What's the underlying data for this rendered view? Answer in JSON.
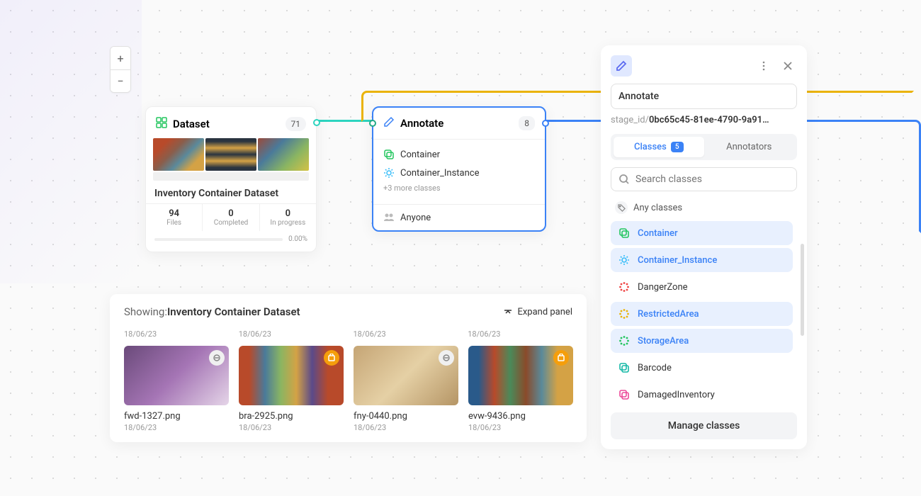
{
  "zoom": {
    "plus": "+",
    "minus": "−"
  },
  "dataset_node": {
    "title": "Dataset",
    "count": "71",
    "name": "Inventory Container Dataset",
    "stats": [
      {
        "num": "94",
        "label": "Files"
      },
      {
        "num": "0",
        "label": "Completed"
      },
      {
        "num": "0",
        "label": "In progress"
      }
    ],
    "progress_pct": "0.00%"
  },
  "annotate_node": {
    "title": "Annotate",
    "count": "8",
    "classes": [
      "Container",
      "Container_Instance"
    ],
    "more": "+3 more classes",
    "assignee": "Anyone"
  },
  "showing_panel": {
    "prefix": "Showing: ",
    "name": "Inventory Container Dataset",
    "expand": "Expand panel",
    "top_dates": [
      "18/06/23",
      "18/06/23",
      "18/06/23",
      "18/06/23"
    ],
    "files": [
      {
        "name": "fwd-1327.png",
        "date": "18/06/23",
        "badge": "gray"
      },
      {
        "name": "bra-2925.png",
        "date": "18/06/23",
        "badge": "orange"
      },
      {
        "name": "fny-0440.png",
        "date": "18/06/23",
        "badge": "gray"
      },
      {
        "name": "evw-9436.png",
        "date": "18/06/23",
        "badge": "orange"
      }
    ]
  },
  "side_panel": {
    "name_value": "Annotate",
    "stage_prefix": "stage_id/",
    "stage_id": "0bc65c45-81ee-4790-9a91…",
    "tabs": {
      "classes": "Classes",
      "classes_count": "5",
      "annotators": "Annotators"
    },
    "search_placeholder": "Search classes",
    "any_classes": "Any classes",
    "classes": [
      {
        "name": "Container",
        "color": "#22c55e",
        "type": "box",
        "selected": true
      },
      {
        "name": "Container_Instance",
        "color": "#38bdf8",
        "type": "gear",
        "selected": true
      },
      {
        "name": "DangerZone",
        "color": "#ef4444",
        "type": "dots",
        "selected": false
      },
      {
        "name": "RestrictedArea",
        "color": "#eab308",
        "type": "dots",
        "selected": true
      },
      {
        "name": "StorageArea",
        "color": "#22c55e",
        "type": "dots",
        "selected": true
      },
      {
        "name": "Barcode",
        "color": "#14b8a6",
        "type": "box",
        "selected": false
      },
      {
        "name": "DamagedInventory",
        "color": "#ec4899",
        "type": "box",
        "selected": false
      }
    ],
    "manage": "Manage classes"
  }
}
